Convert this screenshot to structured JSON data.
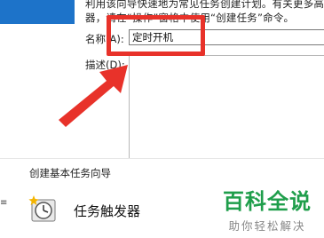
{
  "dialog": {
    "intro_line1": "利用该向导快速地为常见任务创建计划。有关更多高级",
    "intro_line2": "器，请在“操作”窗格中使用“创建任务”命令。",
    "name_label": "名称(A):",
    "name_value": "定时开机",
    "description_label": "描述(D):"
  },
  "annotation": {
    "highlight_color": "#e8322a"
  },
  "wizard": {
    "title": "创建基本任务向导",
    "left_marker": "≡",
    "step_label": "任务触发器"
  },
  "watermark": {
    "title": "百科全说",
    "subtitle": "助你轻松解决",
    "color": "#1f9e4b"
  },
  "colors": {
    "tab_blue": "#1d73c9"
  }
}
